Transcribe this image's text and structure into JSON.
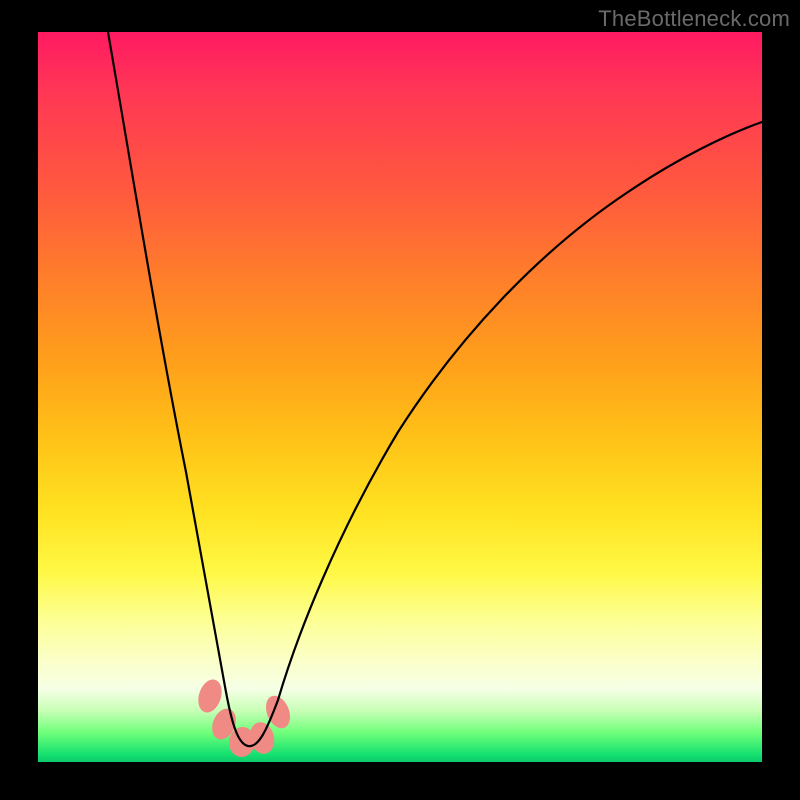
{
  "watermark": {
    "text": "TheBottleneck.com"
  },
  "chart_data": {
    "type": "line",
    "title": "",
    "xlabel": "",
    "ylabel": "",
    "xlim": [
      0,
      100
    ],
    "ylim": [
      0,
      100
    ],
    "grid": false,
    "legend": false,
    "series": [
      {
        "name": "bottleneck-curve",
        "x": [
          10,
          12,
          14,
          16,
          18,
          20,
          22,
          24,
          25,
          26,
          27,
          28,
          29,
          30,
          32,
          34,
          38,
          44,
          52,
          62,
          74,
          88,
          100
        ],
        "y": [
          100,
          86,
          72,
          58,
          45,
          33,
          22,
          12,
          8,
          5,
          3,
          2,
          2,
          3,
          7,
          14,
          25,
          38,
          51,
          62,
          72,
          80,
          85
        ]
      }
    ],
    "markers": [
      {
        "name": "blob-1",
        "x": 24.0,
        "y": 8.0
      },
      {
        "name": "blob-2",
        "x": 25.5,
        "y": 4.5
      },
      {
        "name": "blob-3",
        "x": 27.5,
        "y": 2.0
      },
      {
        "name": "blob-4",
        "x": 30.0,
        "y": 2.5
      },
      {
        "name": "blob-5",
        "x": 32.0,
        "y": 6.5
      }
    ],
    "gradient_stops_pct_top_to_bottom": [
      {
        "pct": 0,
        "color": "#ff1a62"
      },
      {
        "pct": 22,
        "color": "#ff5a3e"
      },
      {
        "pct": 46,
        "color": "#ffa21a"
      },
      {
        "pct": 66,
        "color": "#ffe322"
      },
      {
        "pct": 86,
        "color": "#fbffc8"
      },
      {
        "pct": 96,
        "color": "#6fff7a"
      },
      {
        "pct": 100,
        "color": "#0cc96c"
      }
    ]
  }
}
